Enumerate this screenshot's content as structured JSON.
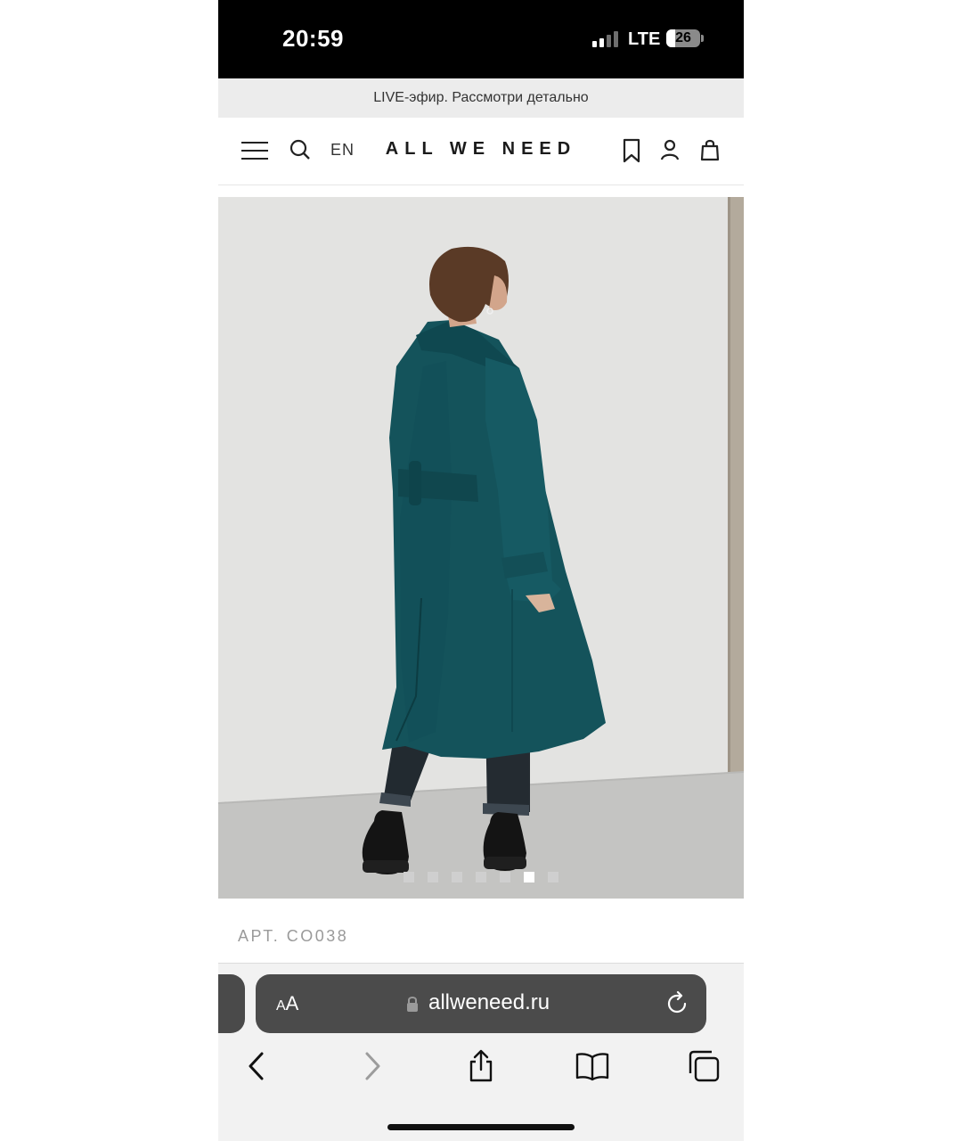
{
  "status_bar": {
    "time": "20:59",
    "network": "LTE",
    "battery": "26",
    "signal_bars_active": 2,
    "signal_bars_total": 4
  },
  "promo": {
    "text": "LIVE-эфир. Рассмотри детально"
  },
  "header": {
    "language": "EN",
    "logo": "ALL WE NEED",
    "icons": [
      "menu-icon",
      "search-icon",
      "bookmark-icon",
      "account-icon",
      "bag-icon"
    ]
  },
  "product": {
    "image_description_icon": "photo",
    "coat_color": "#14535b",
    "gallery": {
      "count": 7,
      "active_index": 5
    },
    "article": "АРТ. CO038"
  },
  "browser": {
    "text_size_label_small": "A",
    "text_size_label_large": "A",
    "url": "allweneed.ru",
    "toolbar": [
      "back-icon",
      "forward-icon",
      "share-icon",
      "bookmarks-icon",
      "tabs-icon"
    ]
  },
  "colors": {
    "accent_coat": "#14535b",
    "banner_bg": "#ececec",
    "address_bar": "#4b4b4b"
  }
}
